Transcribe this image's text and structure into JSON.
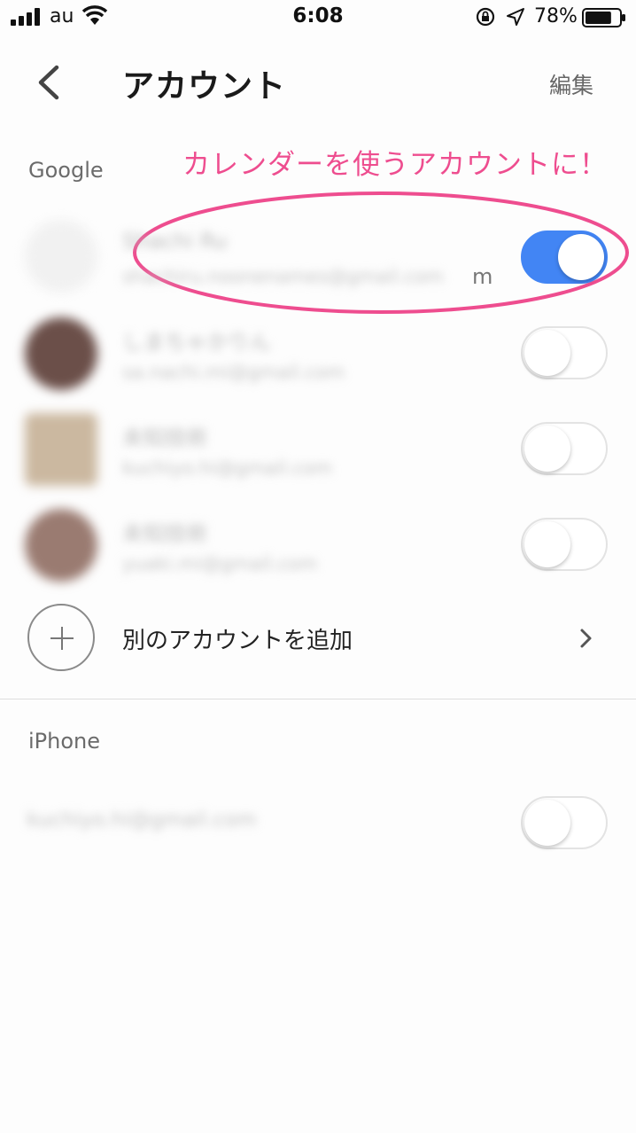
{
  "status_bar": {
    "carrier": "au",
    "time": "6:08",
    "battery_percent": "78%",
    "battery_level": 0.78,
    "icons": [
      "signal-icon",
      "wifi-icon",
      "rotation-lock-icon",
      "location-icon",
      "battery-icon"
    ]
  },
  "header": {
    "title": "アカウント",
    "edit_label": "編集",
    "back_icon": "chevron-left-icon"
  },
  "annotation": {
    "text": "カレンダーを使うアカウントに！",
    "color": "#ee4d8f"
  },
  "google_section": {
    "label": "Google",
    "accounts": [
      {
        "name": "Shachi Ru",
        "email": "shachiru.noonenames@gmail.com",
        "email_tail": "m",
        "enabled": true
      },
      {
        "name": "しまちゃかりん",
        "email": "sa.nachi.mi@gmail.com",
        "enabled": false
      },
      {
        "name": "未知技術",
        "email": "kuchiyo.hi@gmail.com",
        "enabled": false
      },
      {
        "name": "未知技術",
        "email": "yuaki.mi@gmail.com",
        "enabled": false
      }
    ],
    "add_account_label": "別のアカウントを追加"
  },
  "iphone_section": {
    "label": "iPhone",
    "accounts": [
      {
        "email": "kuchiyo.hi@gmail.com",
        "enabled": false
      }
    ]
  },
  "colors": {
    "toggle_on": "#4285f4",
    "annotation": "#ee4d8f"
  }
}
